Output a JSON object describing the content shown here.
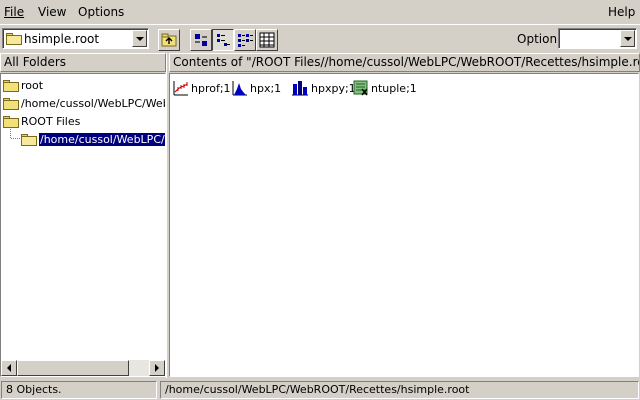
{
  "menubar": {
    "file": "File",
    "view": "View",
    "options": "Options",
    "help": "Help"
  },
  "toolbar": {
    "location_value": "hsimple.root",
    "option_label": "Option",
    "option_value": "",
    "buttons": [
      "folder-up-icon",
      "large-icons-view-icon",
      "small-icons-view-icon",
      "list-view-icon",
      "details-view-icon"
    ]
  },
  "tree": {
    "header": "All Folders",
    "items": [
      {
        "label": "root",
        "icon": "folder-icon"
      },
      {
        "label": "/home/cussol/WebLPC/WebROOT",
        "icon": "folder-icon"
      },
      {
        "label": "ROOT Files",
        "icon": "folder-icon"
      },
      {
        "label": "/home/cussol/WebLPC/WebROOT",
        "icon": "open-folder-icon",
        "selected": true
      }
    ]
  },
  "content": {
    "header": "Contents of \"/ROOT Files//home/cussol/WebLPC/WebROOT/Recettes/hsimple.root\"",
    "objects": [
      {
        "label": "hprof;1",
        "icon": "profile-histogram-icon"
      },
      {
        "label": "hpx;1",
        "icon": "histogram-1d-icon"
      },
      {
        "label": "hpxpy;1",
        "icon": "histogram-2d-icon"
      },
      {
        "label": "ntuple;1",
        "icon": "ntuple-icon"
      }
    ]
  },
  "statusbar": {
    "count": "8 Objects.",
    "path": "/home/cussol/WebLPC/WebROOT/Recettes/hsimple.root"
  }
}
